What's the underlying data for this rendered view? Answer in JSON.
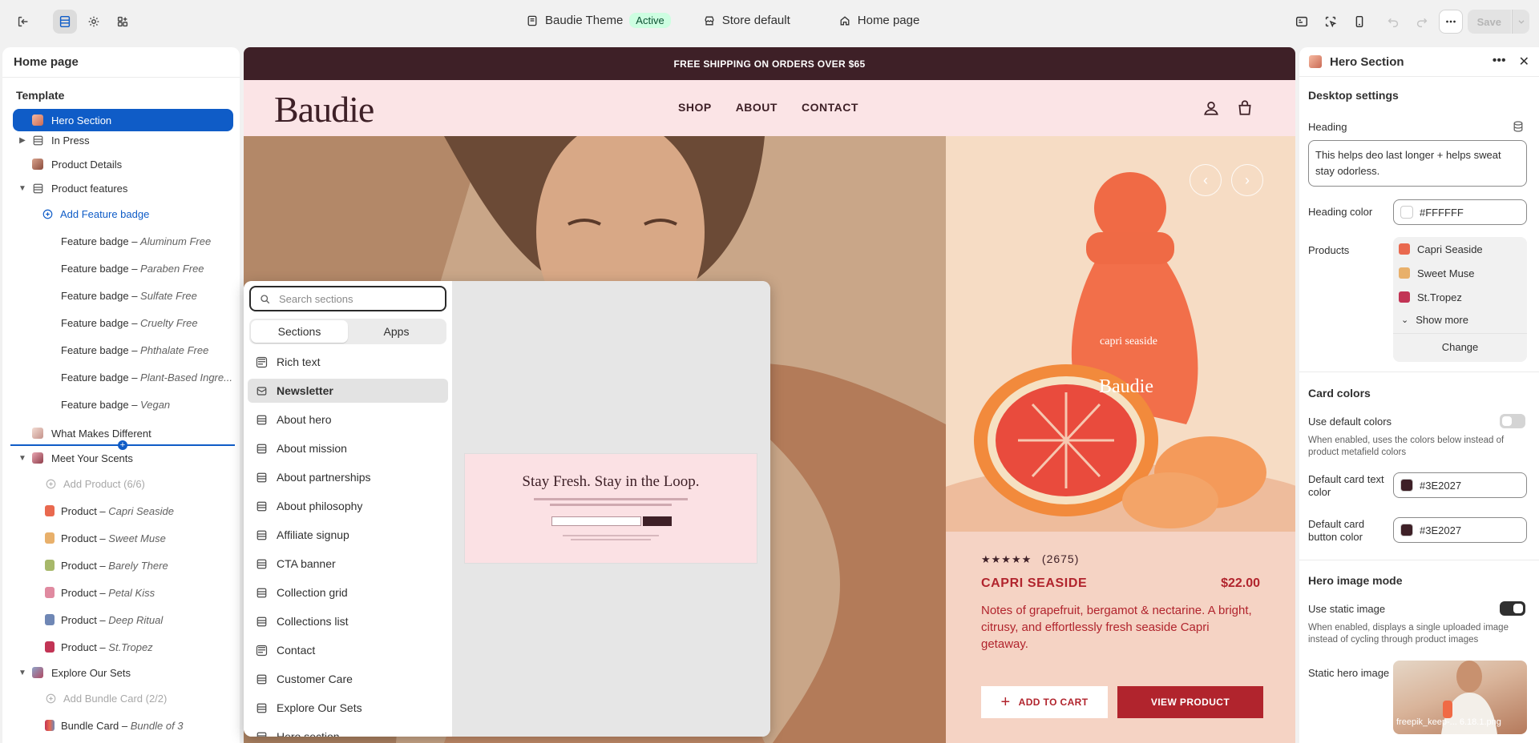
{
  "topbar": {
    "theme_name": "Baudie Theme",
    "theme_status": "Active",
    "store": "Store default",
    "page": "Home page",
    "save_label": "Save"
  },
  "left_panel": {
    "title": "Home page",
    "template_label": "Template",
    "items": [
      {
        "label": "Hero Section"
      },
      {
        "label": "In Press"
      },
      {
        "label": "Product Details"
      },
      {
        "label": "Product features"
      },
      {
        "label": "Add Feature badge"
      },
      {
        "label": "Feature badge",
        "sub": "Aluminum Free"
      },
      {
        "label": "Feature badge",
        "sub": "Paraben Free"
      },
      {
        "label": "Feature badge",
        "sub": "Sulfate Free"
      },
      {
        "label": "Feature badge",
        "sub": "Cruelty Free"
      },
      {
        "label": "Feature badge",
        "sub": "Phthalate Free"
      },
      {
        "label": "Feature badge",
        "sub": "Plant-Based Ingre..."
      },
      {
        "label": "Feature badge",
        "sub": "Vegan"
      },
      {
        "label": "What Makes Different"
      },
      {
        "label": "Meet Your Scents"
      },
      {
        "label": "Add Product (6/6)"
      },
      {
        "label": "Product",
        "sub": "Capri Seaside"
      },
      {
        "label": "Product",
        "sub": "Sweet Muse"
      },
      {
        "label": "Product",
        "sub": "Barely There"
      },
      {
        "label": "Product",
        "sub": "Petal Kiss"
      },
      {
        "label": "Product",
        "sub": "Deep Ritual"
      },
      {
        "label": "Product",
        "sub": "St.Tropez"
      },
      {
        "label": "Explore Our Sets"
      },
      {
        "label": "Add Bundle Card (2/2)"
      },
      {
        "label": "Bundle Card",
        "sub": "Bundle of 3"
      }
    ],
    "separator": " – "
  },
  "preview": {
    "announcement": "FREE SHIPPING ON ORDERS OVER $65",
    "logo": "Baudie",
    "nav": [
      "SHOP",
      "ABOUT",
      "CONTACT"
    ],
    "rating_count": "(2675)",
    "product_name": "CAPRI SEASIDE",
    "product_price": "$22.00",
    "product_desc": "Notes of grapefruit, bergamot & nectarine. A bright, citrusy, and effortlessly fresh seaside Capri getaway.",
    "add_to_cart": "ADD TO CART",
    "view_product": "VIEW PRODUCT",
    "bottle_brand": "Baudie",
    "bottle_text": "capri seaside"
  },
  "picker": {
    "search_placeholder": "Search sections",
    "tabs": [
      "Sections",
      "Apps"
    ],
    "items": [
      "Rich text",
      "Newsletter",
      "About hero",
      "About mission",
      "About partnerships",
      "About philosophy",
      "Affiliate signup",
      "CTA banner",
      "Collection grid",
      "Collections list",
      "Contact",
      "Customer Care",
      "Explore Our Sets",
      "Hero section"
    ],
    "preview_title": "Stay Fresh. Stay in the Loop."
  },
  "right_panel": {
    "title": "Hero Section",
    "desktop_settings": "Desktop settings",
    "heading_label": "Heading",
    "heading_value": "This helps deo last longer + helps sweat stay odorless.",
    "heading_color_label": "Heading color",
    "heading_color": "#FFFFFF",
    "products_label": "Products",
    "products": [
      "Capri Seaside",
      "Sweet Muse",
      "St.Tropez"
    ],
    "show_more": "Show more",
    "change": "Change",
    "card_colors": "Card colors",
    "use_default_colors": "Use default colors",
    "use_default_help": "When enabled, uses the colors below instead of product metafield colors",
    "default_card_text_color_label": "Default card text color",
    "default_card_text_color": "#3E2027",
    "default_card_button_color_label": "Default card button color",
    "default_card_button_color": "#3E2027",
    "hero_image_mode": "Hero image mode",
    "use_static_image": "Use static image",
    "use_static_help": "When enabled, displays a single uploaded image instead of cycling through product images",
    "static_hero_image": "Static hero image",
    "image_filename": "freepik_keep-... 6.18.1.png"
  },
  "colors": {
    "accent": "#0f5cc7",
    "brand_dark": "#3e2027",
    "brand_red": "#b1242d",
    "announcement_bg": "#3e2027"
  }
}
